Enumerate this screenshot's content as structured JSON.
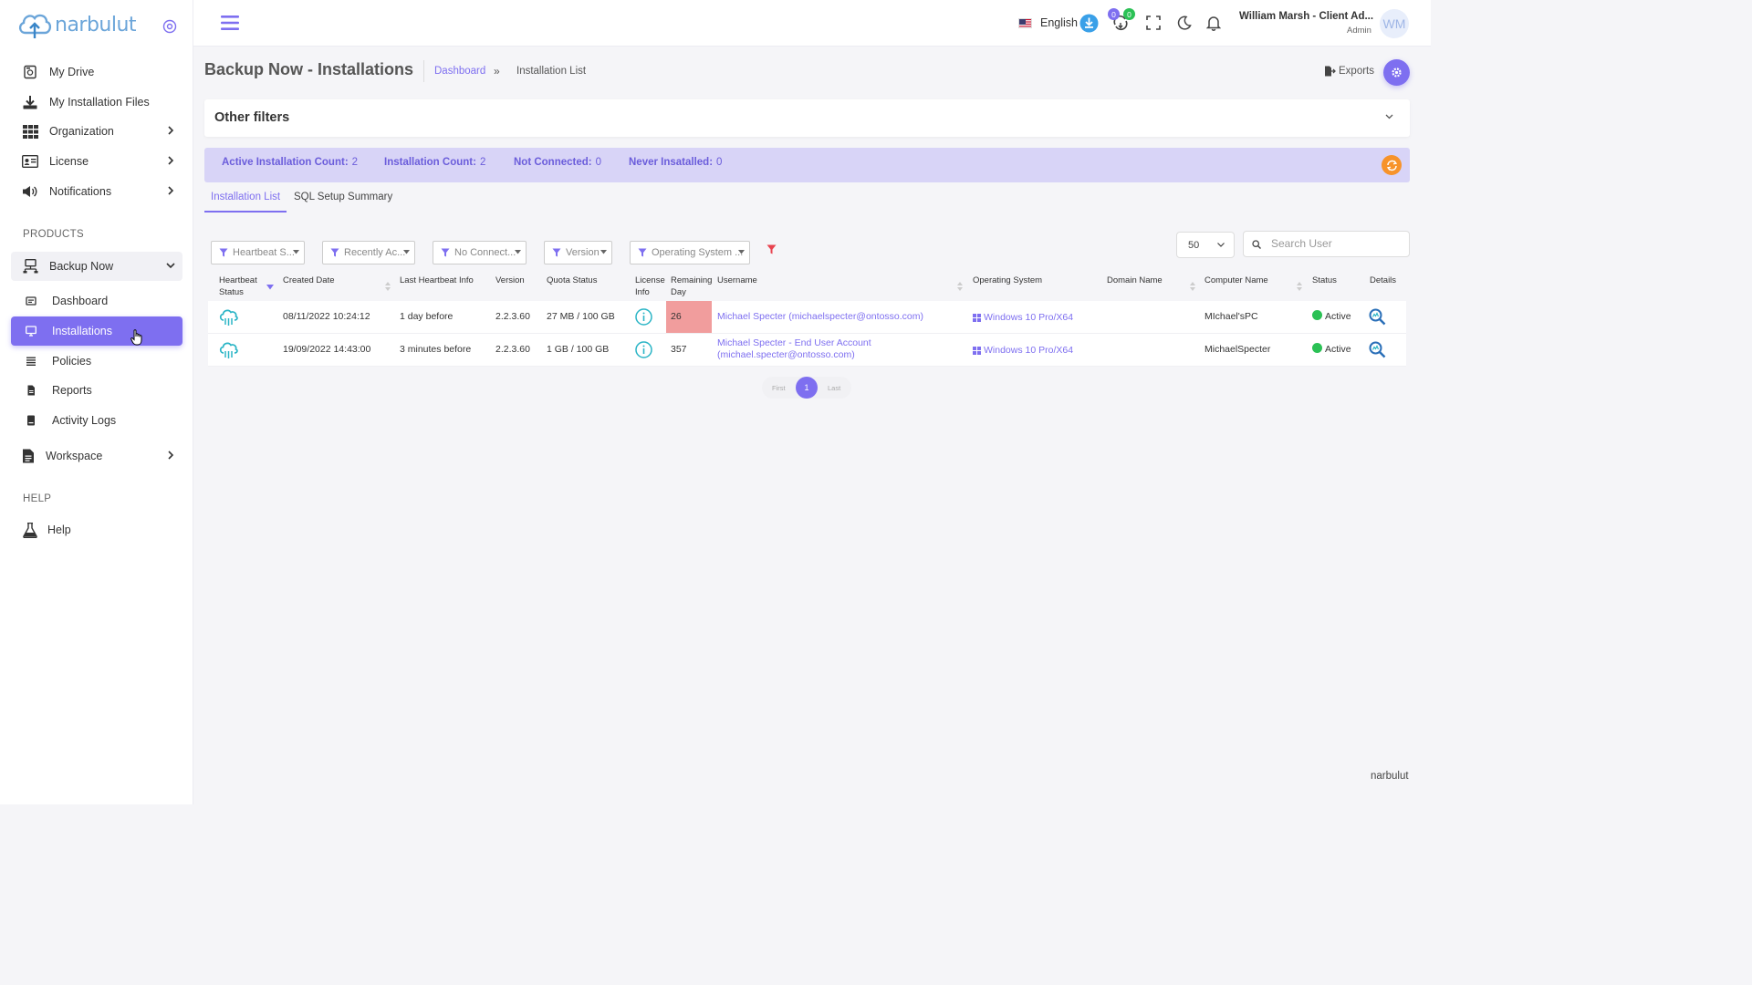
{
  "brand": {
    "logo_text": "narbulut"
  },
  "sidebar": {
    "items": [
      {
        "label": "My Drive"
      },
      {
        "label": "My Installation Files"
      },
      {
        "label": "Organization"
      },
      {
        "label": "License"
      },
      {
        "label": "Notifications"
      }
    ],
    "products_label": "PRODUCTS",
    "product_group": "Backup Now",
    "product_items": [
      {
        "label": "Dashboard"
      },
      {
        "label": "Installations"
      },
      {
        "label": "Policies"
      },
      {
        "label": "Reports"
      },
      {
        "label": "Activity Logs"
      }
    ],
    "workspace": "Workspace",
    "help_label": "HELP",
    "help_item": "Help"
  },
  "topbar": {
    "language": "English",
    "badge_1": "0",
    "badge_2": "0",
    "user_name": "William Marsh - Client Ad...",
    "user_role": "Admin",
    "avatar_initials": "WM"
  },
  "page": {
    "title": "Backup Now - Installations",
    "breadcrumb_link": "Dashboard",
    "breadcrumb_sep": "»",
    "breadcrumb_current": "Installation List",
    "exports_label": "Exports"
  },
  "other_filters": {
    "title": "Other filters"
  },
  "stats": {
    "active_label": "Active Installation Count:",
    "active_value": "2",
    "count_label": "Installation Count:",
    "count_value": "2",
    "not_connected_label": "Not Connected:",
    "not_connected_value": "0",
    "never_label": "Never Insatalled:",
    "never_value": "0"
  },
  "tabs": {
    "installation_list": "Installation List",
    "sql_summary": "SQL Setup Summary"
  },
  "filters": {
    "heartbeat": "Heartbeat S...",
    "recently": "Recently Ac...",
    "no_connect": "No Connect...",
    "version": "Version",
    "os": "Operating System ..."
  },
  "page_size": "50",
  "search": {
    "placeholder": "Search User"
  },
  "table": {
    "headers": {
      "heartbeat_1": "Heartbeat",
      "heartbeat_2": "Status",
      "created": "Created Date",
      "last_hb": "Last Heartbeat Info",
      "version": "Version",
      "quota": "Quota Status",
      "license_1": "License",
      "license_2": "Info",
      "remaining_1": "Remaining",
      "remaining_2": "Day",
      "username": "Username",
      "os": "Operating System",
      "domain": "Domain Name",
      "computer": "Computer Name",
      "status": "Status",
      "details": "Details"
    },
    "rows": [
      {
        "created": "08/11/2022 10:24:12",
        "last_hb": "1 day before",
        "version": "2.2.3.60",
        "quota": "27 MB / 100 GB",
        "remaining": "26",
        "username_1": "Michael Specter (michaelspecter@ontosso.com)",
        "username_2": "",
        "os": "Windows 10 Pro/X64",
        "domain": "",
        "computer": "MIchael'sPC",
        "status": "Active"
      },
      {
        "created": "19/09/2022 14:43:00",
        "last_hb": "3 minutes before",
        "version": "2.2.3.60",
        "quota": "1 GB / 100 GB",
        "remaining": "357",
        "username_1": "Michael Specter - End User Account",
        "username_2": "(michael.specter@ontosso.com)",
        "os": "Windows 10 Pro/X64",
        "domain": "",
        "computer": "MichaelSpecter",
        "status": "Active"
      }
    ]
  },
  "pagination": {
    "first": "First",
    "current": "1",
    "last": "Last"
  },
  "footer": {
    "text": "narbulut"
  },
  "colors": {
    "accent": "#7e6ff0",
    "stats_bg": "#d8d4f7",
    "danger_cell": "#f19d9d",
    "active_green": "#2bc155",
    "refresh_orange": "#f7932a",
    "cloud_teal": "#2bb5c6"
  }
}
